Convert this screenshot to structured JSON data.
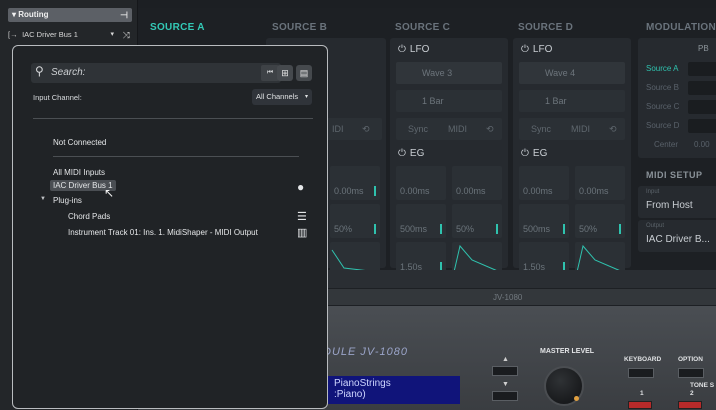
{
  "routing": {
    "header": "Routing",
    "collapse_icon": "x-collapse",
    "input_row": {
      "icon": "input-arrow-icon",
      "value": "IAC Driver Bus 1",
      "shuffle_icon": "shuffle-icon"
    }
  },
  "synth": {
    "tabs": [
      "SOURCE A",
      "SOURCE B",
      "SOURCE C",
      "SOURCE D"
    ],
    "active_tab": "SOURCE A",
    "modulation_title": "MODULATION",
    "columns": [
      {
        "lfo": "LFO",
        "wave": "Wave 3",
        "bar": "1 Bar",
        "sync": "Sync",
        "midi": "MIDI",
        "eg": "EG",
        "eg_values": [
          "0.00ms",
          "0.00ms",
          "500ms",
          "50%",
          "1.50s"
        ]
      },
      {
        "lfo": "LFO",
        "wave": "Wave 4",
        "bar": "1 Bar",
        "sync": "Sync",
        "midi": "MIDI",
        "eg": "EG",
        "eg_values": [
          "0.00ms",
          "0.00ms",
          "500ms",
          "50%",
          "1.50s"
        ]
      }
    ],
    "partial_values": {
      "midi": "IDI",
      "eg_1": "0.00ms",
      "eg_2": "50%"
    },
    "modulation": {
      "pb_label": "PB",
      "sources": [
        "Source A",
        "Source B",
        "Source C",
        "Source D",
        "Center"
      ],
      "active_source": "Source A",
      "center_value": "0.00"
    },
    "midi_setup": {
      "title": "MIDI SETUP",
      "input_label": "Input",
      "input_value": "From Host",
      "output_label": "Output",
      "output_value": "IAC Driver B..."
    },
    "hardware": {
      "strip_label": "JV-1080",
      "logo": "DULE JV-1080",
      "lcd_line1": "PianoStrings",
      "lcd_line2": ":Piano)",
      "master_level": "MASTER LEVEL",
      "keyboard": "KEYBOARD",
      "option": "OPTION",
      "tone_s": "TONE S",
      "num1": "1",
      "num2": "2"
    }
  },
  "popup": {
    "search_placeholder": "Search:",
    "input_channel_label": "Input Channel:",
    "input_channel_value": "All Channels",
    "not_connected": "Not Connected",
    "all_midi_inputs": "All MIDI Inputs",
    "selected_item": "IAC Driver Bus 1",
    "plugins_group": "Plug-ins",
    "plugins": [
      "Chord Pads",
      "Instrument Track 01: Ins. 1. MidiShaper - MIDI Output"
    ]
  }
}
